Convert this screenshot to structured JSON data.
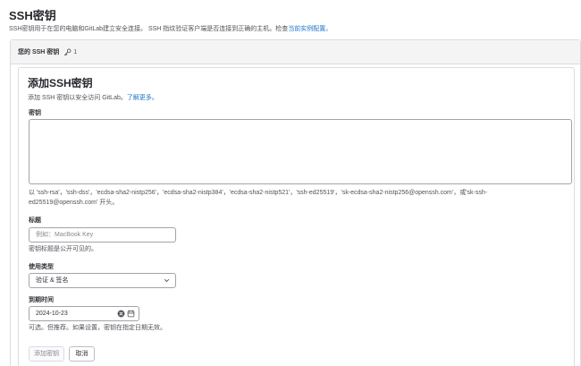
{
  "page": {
    "title": "SSH密钥",
    "description": "SSH密钥用于在您的电脑和GitLab建立安全连接。 SSH 指纹验证客户端是否连接到正确的主机。检查",
    "description_link": "当前实例配置。"
  },
  "keys_card": {
    "header_label": "您的 SSH 密钥",
    "count": "1"
  },
  "form": {
    "title": "添加SSH密钥",
    "description": "添加 SSH 密钥以安全访问 GitLab。",
    "description_link": "了解更多。",
    "key": {
      "label": "密钥",
      "value": "",
      "help_line1": "以 'ssh-rsa'，'ssh-dss'，'ecdsa-sha2-nistp256'，'ecdsa-sha2-nistp384'，'ecdsa-sha2-nistp521'，'ssh-ed25519'，'sk-ecdsa-sha2-nistp256@openssh.com'，或'sk-ssh-",
      "help_line2": "ed25519@openssh.com' 开头。"
    },
    "title_field": {
      "label": "标题",
      "placeholder": "例如：MacBook Key",
      "help": "密钥标题是公开可见的。"
    },
    "usage_type": {
      "label": "使用类型",
      "selected": "验证 & 签名"
    },
    "expiry": {
      "label": "到期时间",
      "value": "2024-10-23",
      "help": "可选。但推荐。如果设置，密钥在指定日期无效。"
    },
    "buttons": {
      "add": "添加密钥",
      "cancel": "取消"
    }
  },
  "icons": {
    "key": "key-icon",
    "chevron": "chevron-down-icon",
    "clear": "clear-icon",
    "calendar": "calendar-icon"
  }
}
